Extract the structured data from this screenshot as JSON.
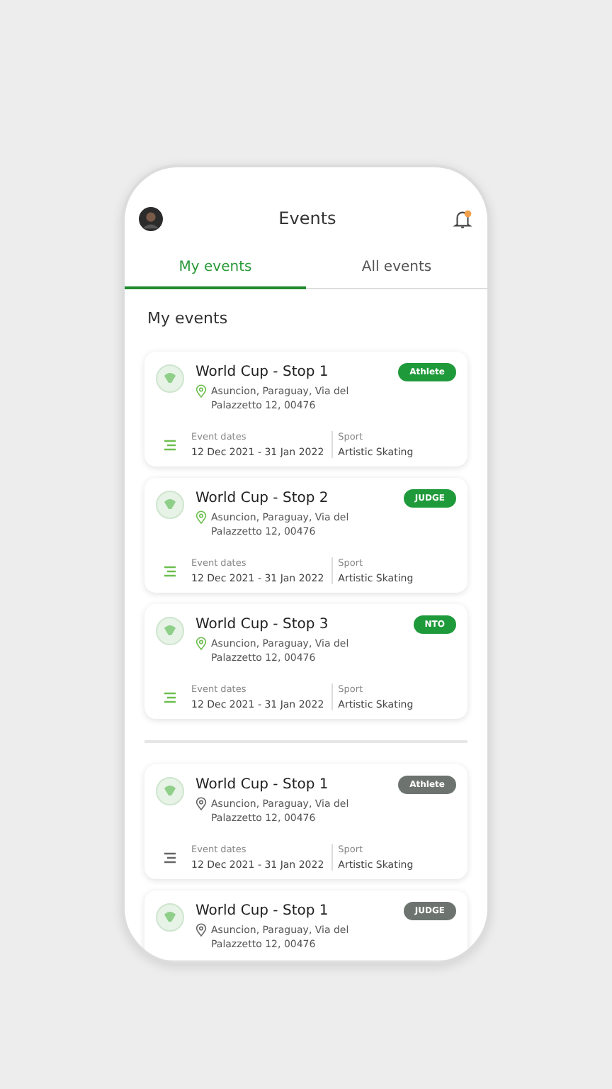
{
  "header": {
    "title": "Events",
    "has_notification": true
  },
  "tabs": [
    {
      "label": "My events",
      "selected": true
    },
    {
      "label": "All events",
      "selected": false
    }
  ],
  "section_title": "My events",
  "groups": [
    {
      "events": [
        {
          "title": "World Cup - Stop 1",
          "address": "Asuncion, Paraguay, Via del Palazzetto 12, 00476",
          "role": "Athlete",
          "active": true,
          "dates_label": "Event dates",
          "dates": "12 Dec 2021 - 31 Jan 2022",
          "sport_label": "Sport",
          "sport": "Artistic Skating"
        },
        {
          "title": "World Cup - Stop 2",
          "address": "Asuncion, Paraguay, Via del Palazzetto 12, 00476",
          "role": "JUDGE",
          "active": true,
          "dates_label": "Event dates",
          "dates": "12 Dec 2021 - 31 Jan 2022",
          "sport_label": "Sport",
          "sport": "Artistic Skating"
        },
        {
          "title": "World Cup - Stop 3",
          "address": "Asuncion, Paraguay, Via del Palazzetto 12, 00476",
          "role": "NTO",
          "active": true,
          "dates_label": "Event dates",
          "dates": "12 Dec 2021 - 31 Jan 2022",
          "sport_label": "Sport",
          "sport": "Artistic Skating"
        }
      ]
    },
    {
      "events": [
        {
          "title": "World Cup - Stop 1",
          "address": "Asuncion, Paraguay, Via del Palazzetto 12, 00476",
          "role": "Athlete",
          "active": false,
          "dates_label": "Event dates",
          "dates": "12 Dec 2021 - 31 Jan 2022",
          "sport_label": "Sport",
          "sport": "Artistic Skating"
        },
        {
          "title": "World Cup - Stop 1",
          "address": "Asuncion, Paraguay, Via del Palazzetto 12, 00476",
          "role": "JUDGE",
          "active": false
        }
      ]
    }
  ]
}
